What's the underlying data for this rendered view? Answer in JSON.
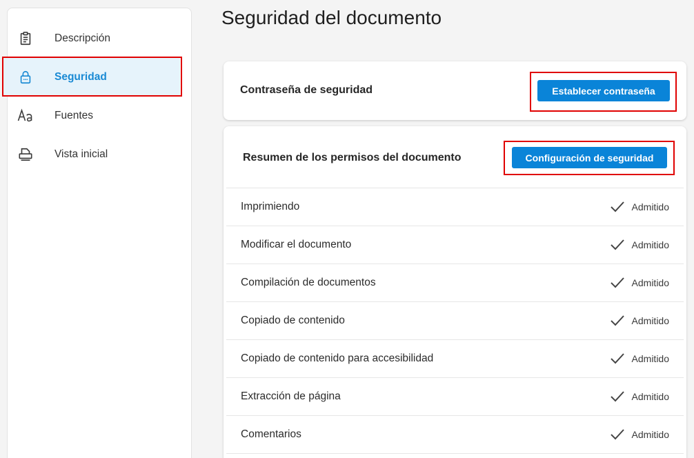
{
  "sidebar": {
    "items": [
      {
        "label": "Descripción",
        "icon": "clipboard-icon"
      },
      {
        "label": "Seguridad",
        "icon": "lock-icon",
        "active": true
      },
      {
        "label": "Fuentes",
        "icon": "font-aa-icon"
      },
      {
        "label": "Vista inicial",
        "icon": "printer-icon"
      }
    ]
  },
  "main": {
    "title": "Seguridad del documento",
    "password_card": {
      "label": "Contraseña de seguridad",
      "button": "Establecer contraseña"
    },
    "permissions_card": {
      "label": "Resumen de los permisos del documento",
      "button": "Configuración de seguridad",
      "rows": [
        {
          "name": "Imprimiendo",
          "status": "Admitido"
        },
        {
          "name": "Modificar el documento",
          "status": "Admitido"
        },
        {
          "name": "Compilación de documentos",
          "status": "Admitido"
        },
        {
          "name": "Copiado de contenido",
          "status": "Admitido"
        },
        {
          "name": "Copiado de contenido para accesibilidad",
          "status": "Admitido"
        },
        {
          "name": "Extracción de página",
          "status": "Admitido"
        },
        {
          "name": "Comentarios",
          "status": "Admitido"
        }
      ]
    }
  },
  "colors": {
    "accent": "#0a84d8",
    "active_bg": "#e6f3fb",
    "highlight": "#e00000"
  }
}
